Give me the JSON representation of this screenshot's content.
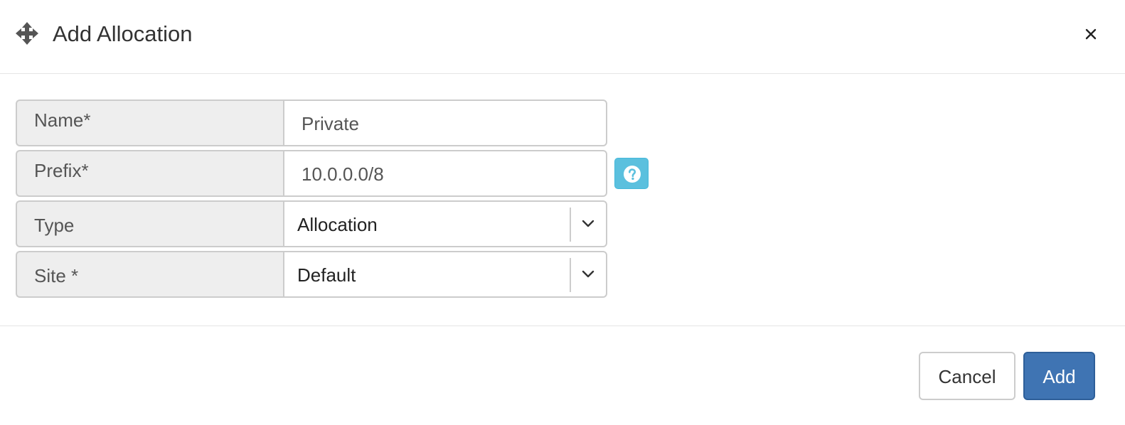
{
  "dialog": {
    "title": "Add Allocation",
    "header_icon": "move-arrows-icon",
    "close_icon": "close-icon"
  },
  "form": {
    "name": {
      "label": "Name*",
      "value": "Private"
    },
    "prefix": {
      "label": "Prefix*",
      "value": "10.0.0.0/8",
      "help_icon": "question-circle-icon"
    },
    "type": {
      "label": "Type",
      "selected": "Allocation"
    },
    "site": {
      "label": "Site *",
      "selected": "Default"
    }
  },
  "footer": {
    "cancel_label": "Cancel",
    "add_label": "Add"
  },
  "colors": {
    "primary": "#3f74b3",
    "info": "#5bc0de",
    "label_bg": "#eeeeee",
    "border": "#cccccc"
  }
}
